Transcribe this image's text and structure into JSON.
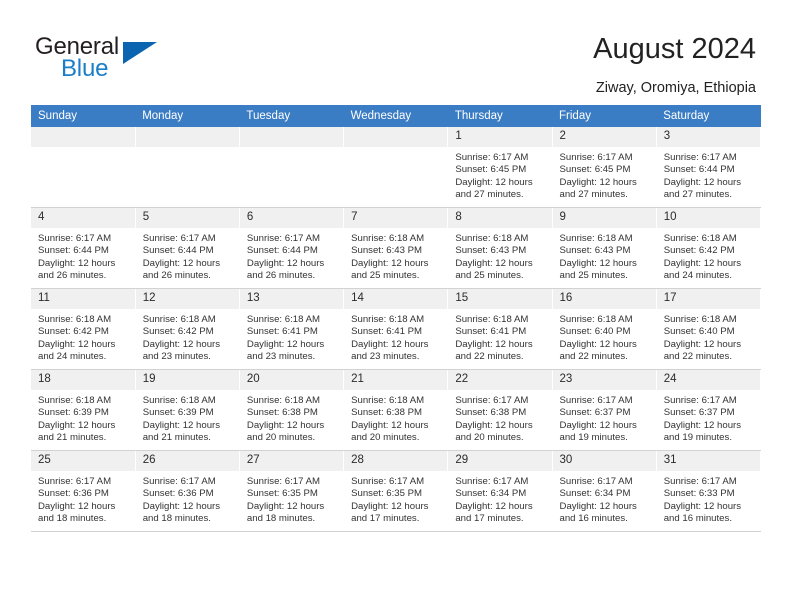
{
  "brand": {
    "name_part1": "General",
    "name_part2": "Blue",
    "triangle_color": "#0a64b0",
    "blue_text_color": "#1a7ec8"
  },
  "header": {
    "title": "August 2024",
    "location": "Ziway, Oromiya, Ethiopia",
    "header_bg_color": "#3b7dc4",
    "header_text_color": "#ffffff"
  },
  "calendar": {
    "weekday_headers": [
      "Sunday",
      "Monday",
      "Tuesday",
      "Wednesday",
      "Thursday",
      "Friday",
      "Saturday"
    ],
    "weeks": [
      [
        {
          "day": "",
          "empty": true
        },
        {
          "day": "",
          "empty": true
        },
        {
          "day": "",
          "empty": true
        },
        {
          "day": "",
          "empty": true
        },
        {
          "day": "1",
          "sunrise": "Sunrise: 6:17 AM",
          "sunset": "Sunset: 6:45 PM",
          "daylight_line1": "Daylight: 12 hours",
          "daylight_line2": "and 27 minutes."
        },
        {
          "day": "2",
          "sunrise": "Sunrise: 6:17 AM",
          "sunset": "Sunset: 6:45 PM",
          "daylight_line1": "Daylight: 12 hours",
          "daylight_line2": "and 27 minutes."
        },
        {
          "day": "3",
          "sunrise": "Sunrise: 6:17 AM",
          "sunset": "Sunset: 6:44 PM",
          "daylight_line1": "Daylight: 12 hours",
          "daylight_line2": "and 27 minutes."
        }
      ],
      [
        {
          "day": "4",
          "sunrise": "Sunrise: 6:17 AM",
          "sunset": "Sunset: 6:44 PM",
          "daylight_line1": "Daylight: 12 hours",
          "daylight_line2": "and 26 minutes."
        },
        {
          "day": "5",
          "sunrise": "Sunrise: 6:17 AM",
          "sunset": "Sunset: 6:44 PM",
          "daylight_line1": "Daylight: 12 hours",
          "daylight_line2": "and 26 minutes."
        },
        {
          "day": "6",
          "sunrise": "Sunrise: 6:17 AM",
          "sunset": "Sunset: 6:44 PM",
          "daylight_line1": "Daylight: 12 hours",
          "daylight_line2": "and 26 minutes."
        },
        {
          "day": "7",
          "sunrise": "Sunrise: 6:18 AM",
          "sunset": "Sunset: 6:43 PM",
          "daylight_line1": "Daylight: 12 hours",
          "daylight_line2": "and 25 minutes."
        },
        {
          "day": "8",
          "sunrise": "Sunrise: 6:18 AM",
          "sunset": "Sunset: 6:43 PM",
          "daylight_line1": "Daylight: 12 hours",
          "daylight_line2": "and 25 minutes."
        },
        {
          "day": "9",
          "sunrise": "Sunrise: 6:18 AM",
          "sunset": "Sunset: 6:43 PM",
          "daylight_line1": "Daylight: 12 hours",
          "daylight_line2": "and 25 minutes."
        },
        {
          "day": "10",
          "sunrise": "Sunrise: 6:18 AM",
          "sunset": "Sunset: 6:42 PM",
          "daylight_line1": "Daylight: 12 hours",
          "daylight_line2": "and 24 minutes."
        }
      ],
      [
        {
          "day": "11",
          "sunrise": "Sunrise: 6:18 AM",
          "sunset": "Sunset: 6:42 PM",
          "daylight_line1": "Daylight: 12 hours",
          "daylight_line2": "and 24 minutes."
        },
        {
          "day": "12",
          "sunrise": "Sunrise: 6:18 AM",
          "sunset": "Sunset: 6:42 PM",
          "daylight_line1": "Daylight: 12 hours",
          "daylight_line2": "and 23 minutes."
        },
        {
          "day": "13",
          "sunrise": "Sunrise: 6:18 AM",
          "sunset": "Sunset: 6:41 PM",
          "daylight_line1": "Daylight: 12 hours",
          "daylight_line2": "and 23 minutes."
        },
        {
          "day": "14",
          "sunrise": "Sunrise: 6:18 AM",
          "sunset": "Sunset: 6:41 PM",
          "daylight_line1": "Daylight: 12 hours",
          "daylight_line2": "and 23 minutes."
        },
        {
          "day": "15",
          "sunrise": "Sunrise: 6:18 AM",
          "sunset": "Sunset: 6:41 PM",
          "daylight_line1": "Daylight: 12 hours",
          "daylight_line2": "and 22 minutes."
        },
        {
          "day": "16",
          "sunrise": "Sunrise: 6:18 AM",
          "sunset": "Sunset: 6:40 PM",
          "daylight_line1": "Daylight: 12 hours",
          "daylight_line2": "and 22 minutes."
        },
        {
          "day": "17",
          "sunrise": "Sunrise: 6:18 AM",
          "sunset": "Sunset: 6:40 PM",
          "daylight_line1": "Daylight: 12 hours",
          "daylight_line2": "and 22 minutes."
        }
      ],
      [
        {
          "day": "18",
          "sunrise": "Sunrise: 6:18 AM",
          "sunset": "Sunset: 6:39 PM",
          "daylight_line1": "Daylight: 12 hours",
          "daylight_line2": "and 21 minutes."
        },
        {
          "day": "19",
          "sunrise": "Sunrise: 6:18 AM",
          "sunset": "Sunset: 6:39 PM",
          "daylight_line1": "Daylight: 12 hours",
          "daylight_line2": "and 21 minutes."
        },
        {
          "day": "20",
          "sunrise": "Sunrise: 6:18 AM",
          "sunset": "Sunset: 6:38 PM",
          "daylight_line1": "Daylight: 12 hours",
          "daylight_line2": "and 20 minutes."
        },
        {
          "day": "21",
          "sunrise": "Sunrise: 6:18 AM",
          "sunset": "Sunset: 6:38 PM",
          "daylight_line1": "Daylight: 12 hours",
          "daylight_line2": "and 20 minutes."
        },
        {
          "day": "22",
          "sunrise": "Sunrise: 6:17 AM",
          "sunset": "Sunset: 6:38 PM",
          "daylight_line1": "Daylight: 12 hours",
          "daylight_line2": "and 20 minutes."
        },
        {
          "day": "23",
          "sunrise": "Sunrise: 6:17 AM",
          "sunset": "Sunset: 6:37 PM",
          "daylight_line1": "Daylight: 12 hours",
          "daylight_line2": "and 19 minutes."
        },
        {
          "day": "24",
          "sunrise": "Sunrise: 6:17 AM",
          "sunset": "Sunset: 6:37 PM",
          "daylight_line1": "Daylight: 12 hours",
          "daylight_line2": "and 19 minutes."
        }
      ],
      [
        {
          "day": "25",
          "sunrise": "Sunrise: 6:17 AM",
          "sunset": "Sunset: 6:36 PM",
          "daylight_line1": "Daylight: 12 hours",
          "daylight_line2": "and 18 minutes."
        },
        {
          "day": "26",
          "sunrise": "Sunrise: 6:17 AM",
          "sunset": "Sunset: 6:36 PM",
          "daylight_line1": "Daylight: 12 hours",
          "daylight_line2": "and 18 minutes."
        },
        {
          "day": "27",
          "sunrise": "Sunrise: 6:17 AM",
          "sunset": "Sunset: 6:35 PM",
          "daylight_line1": "Daylight: 12 hours",
          "daylight_line2": "and 18 minutes."
        },
        {
          "day": "28",
          "sunrise": "Sunrise: 6:17 AM",
          "sunset": "Sunset: 6:35 PM",
          "daylight_line1": "Daylight: 12 hours",
          "daylight_line2": "and 17 minutes."
        },
        {
          "day": "29",
          "sunrise": "Sunrise: 6:17 AM",
          "sunset": "Sunset: 6:34 PM",
          "daylight_line1": "Daylight: 12 hours",
          "daylight_line2": "and 17 minutes."
        },
        {
          "day": "30",
          "sunrise": "Sunrise: 6:17 AM",
          "sunset": "Sunset: 6:34 PM",
          "daylight_line1": "Daylight: 12 hours",
          "daylight_line2": "and 16 minutes."
        },
        {
          "day": "31",
          "sunrise": "Sunrise: 6:17 AM",
          "sunset": "Sunset: 6:33 PM",
          "daylight_line1": "Daylight: 12 hours",
          "daylight_line2": "and 16 minutes."
        }
      ]
    ]
  }
}
